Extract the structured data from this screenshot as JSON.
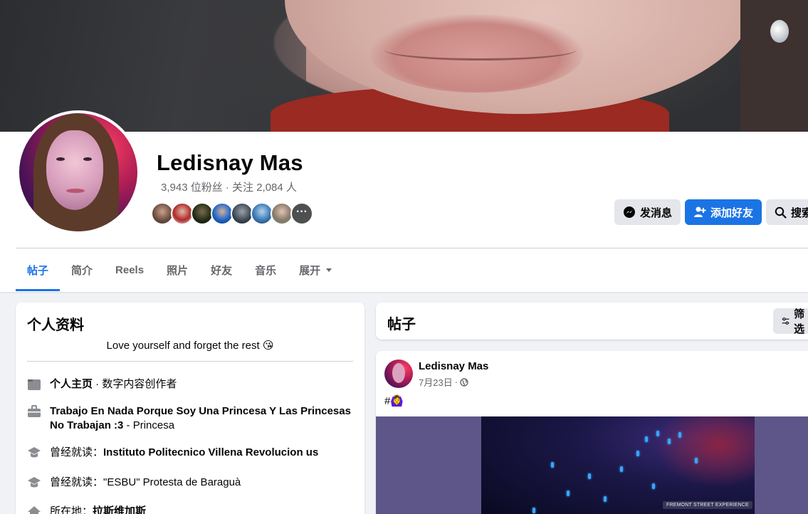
{
  "profile": {
    "name": "Ledisnay Mas",
    "stats": "3,943 位粉丝 · 关注 2,084 人",
    "more_friends_glyph": "···"
  },
  "actions": {
    "message_label": "发消息",
    "add_friend_label": "添加好友",
    "search_label": "搜索"
  },
  "tabs": [
    {
      "label": "帖子",
      "active": true
    },
    {
      "label": "简介"
    },
    {
      "label": "Reels"
    },
    {
      "label": "照片"
    },
    {
      "label": "好友"
    },
    {
      "label": "音乐"
    },
    {
      "label": "展开"
    }
  ],
  "intro": {
    "title": "个人资料",
    "bio": "Love yourself and forget the rest 😘",
    "rows": [
      {
        "icon": "page-icon",
        "bold": "个人主页",
        "text": " · 数字内容创作者"
      },
      {
        "icon": "work-icon",
        "bold": "Trabajo En Nada Porque Soy Una Princesa Y Las Princesas No Trabajan :3",
        "text": " - Princesa"
      },
      {
        "icon": "education-icon",
        "prefix": "曾经就读：",
        "bold": "Instituto Politecnico Villena Revolucion us",
        "text": ""
      },
      {
        "icon": "education-icon",
        "prefix": "曾经就读：",
        "bold": "",
        "text": "\"ESBU\" Protesta de Baraguà"
      },
      {
        "icon": "home-icon",
        "prefix": "所在地：",
        "bold": "拉斯维加斯",
        "text": ""
      }
    ]
  },
  "posts": {
    "title": "帖子",
    "filter_label": "筛选"
  },
  "post": {
    "author": "Ledisnay Mas",
    "date": "7月23日",
    "separator": "·",
    "text": "#🙆‍♀️",
    "watermark": "FREMONT STREET EXPERIENCE"
  },
  "colors": {
    "accent": "#1b74e4",
    "background": "#f0f2f5",
    "secondary_text": "#65676b"
  }
}
